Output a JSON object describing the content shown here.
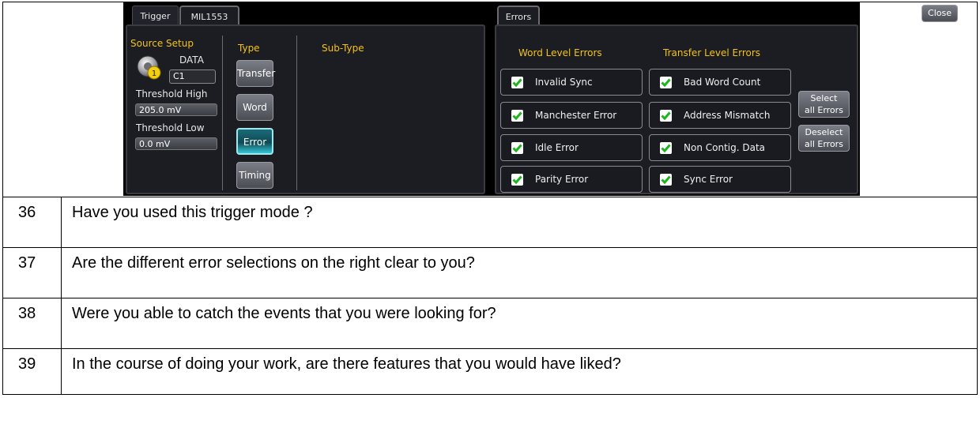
{
  "left_panel": {
    "tabs": [
      "Trigger",
      "MIL1553"
    ],
    "source_setup_label": "Source Setup",
    "source_name": "DATA",
    "source_channel": "C1",
    "threshold_high_label": "Threshold High",
    "threshold_high_value": "205.0 mV",
    "threshold_low_label": "Threshold Low",
    "threshold_low_value": "0.0 mV",
    "type_label": "Type",
    "subtype_label": "Sub-Type",
    "type_buttons": [
      "Transfer",
      "Word",
      "Error",
      "Timing"
    ],
    "selected_type": "Error"
  },
  "right_panel": {
    "tab": "Errors",
    "close_label": "Close",
    "word_level_header": "Word Level Errors",
    "transfer_level_header": "Transfer Level Errors",
    "word_errors": [
      "Invalid Sync",
      "Manchester Error",
      "Idle Error",
      "Parity Error"
    ],
    "transfer_errors": [
      "Bad Word Count",
      "Address Mismatch",
      "Non Contig. Data",
      "Sync Error"
    ],
    "select_all_line1": "Select",
    "select_all_line2": "all Errors",
    "deselect_all_line1": "Deselect",
    "deselect_all_line2": "all Errors"
  },
  "accent_yellow": "#f3c21b",
  "check_green": "#1db41d",
  "questions": [
    {
      "number": "36",
      "text": "Have you used this trigger mode ?"
    },
    {
      "number": "37",
      "text": "Are the different error selections on the right clear to you?"
    },
    {
      "number": "38",
      "text": "Were you able to catch the events that you were looking for?"
    },
    {
      "number": "39",
      "text": "In the course of doing your work, are there features that you would have liked?"
    }
  ]
}
